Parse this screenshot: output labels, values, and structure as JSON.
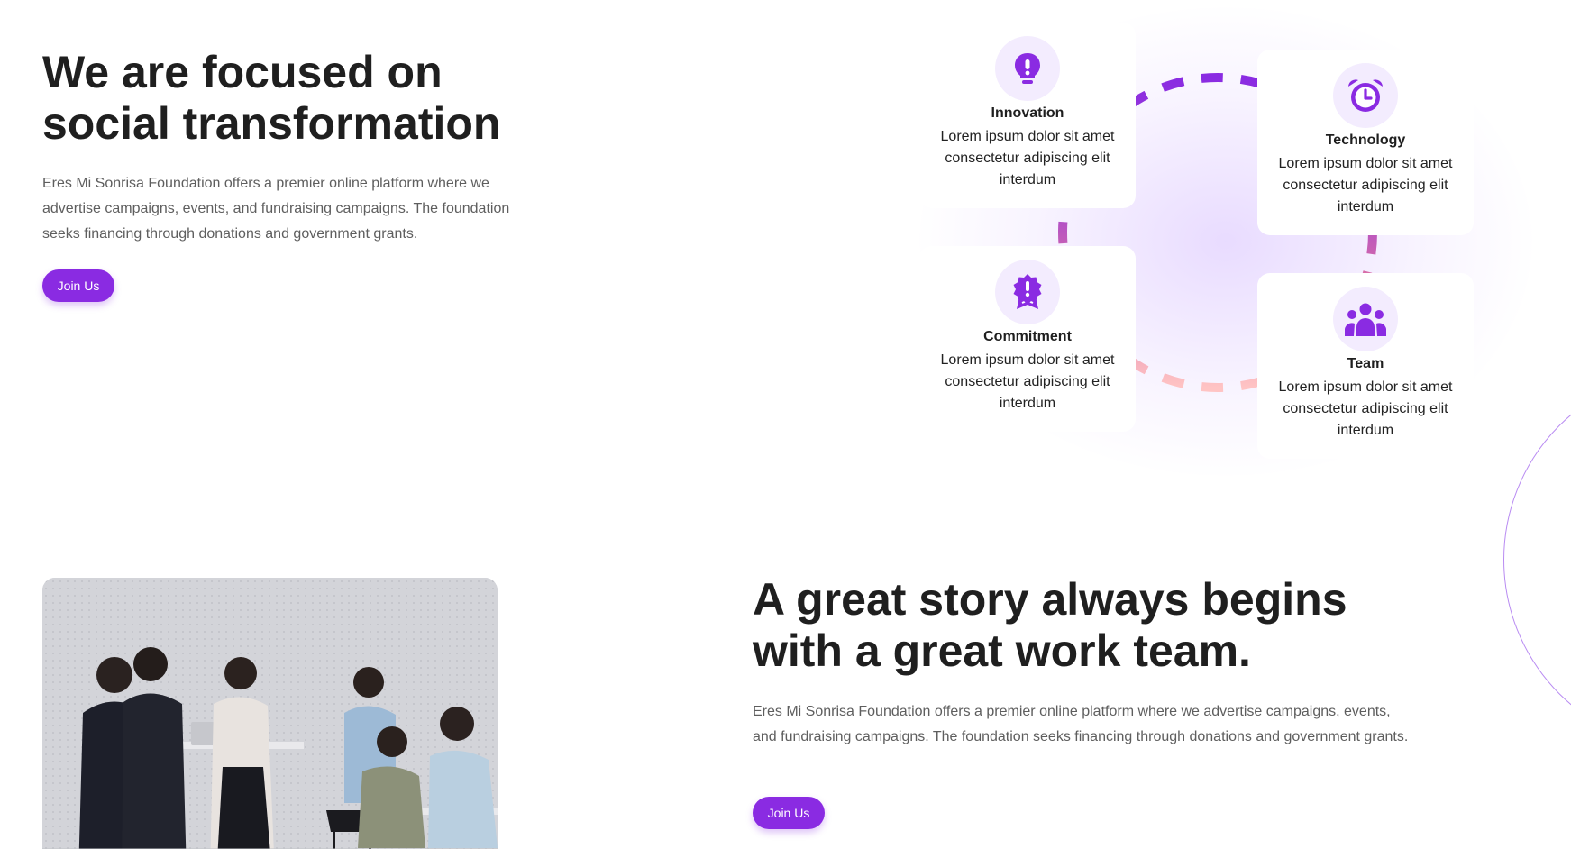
{
  "hero": {
    "title": "We are focused on social transformation",
    "text": "Eres Mi Sonrisa Foundation offers a premier online platform where we advertise campaigns, events, and fundraising campaigns. The foundation seeks financing through donations and government grants.",
    "button_label": "Join Us"
  },
  "values": [
    {
      "title": "Innovation",
      "text": "Lorem ipsum dolor sit amet consectetur adipiscing elit interdum",
      "icon": "lightbulb-icon"
    },
    {
      "title": "Technology",
      "text": "Lorem ipsum dolor sit amet consectetur adipiscing elit interdum",
      "icon": "alarm-clock-icon"
    },
    {
      "title": "Commitment",
      "text": "Lorem ipsum dolor sit amet consectetur adipiscing elit interdum",
      "icon": "award-badge-icon"
    },
    {
      "title": "Team",
      "text": "Lorem ipsum dolor sit amet consectetur adipiscing elit interdum",
      "icon": "team-group-icon"
    }
  ],
  "story": {
    "title": "A great story always begins with a great work team.",
    "text": "Eres Mi Sonrisa Foundation offers a premier online platform where we advertise campaigns, events, and fundraising campaigns. The foundation seeks financing through donations and government grants.",
    "button_label": "Join Us"
  },
  "colors": {
    "accent": "#8a2be2",
    "icon_bg": "#f3ecfe",
    "heading": "#1f1f1f",
    "body_text": "#5e5e5e",
    "ring_purple": "#8a2be2",
    "ring_pink": "#d66ba8",
    "ring_peach": "#ffb8b8"
  }
}
